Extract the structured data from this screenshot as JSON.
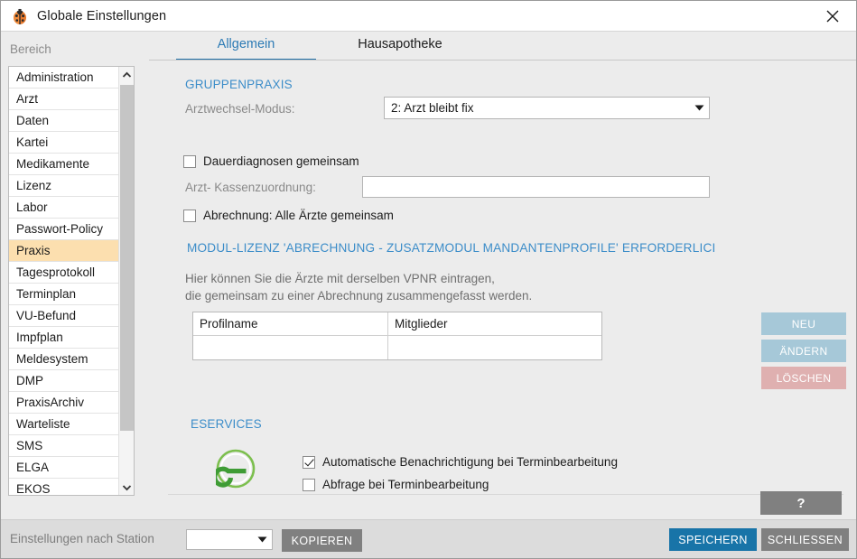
{
  "window": {
    "title": "Globale Einstellungen",
    "app_icon": "ladybug-icon",
    "close_icon": "close-icon"
  },
  "sidebar": {
    "header": "Bereich",
    "selected": "Praxis",
    "items": [
      {
        "label": "Administration"
      },
      {
        "label": "Arzt"
      },
      {
        "label": "Daten"
      },
      {
        "label": "Kartei"
      },
      {
        "label": "Medikamente"
      },
      {
        "label": "Lizenz"
      },
      {
        "label": "Labor"
      },
      {
        "label": "Passwort-Policy"
      },
      {
        "label": "Praxis"
      },
      {
        "label": "Tagesprotokoll"
      },
      {
        "label": "Terminplan"
      },
      {
        "label": "VU-Befund"
      },
      {
        "label": "Impfplan"
      },
      {
        "label": "Meldesystem"
      },
      {
        "label": "DMP"
      },
      {
        "label": "PraxisArchiv"
      },
      {
        "label": "Warteliste"
      },
      {
        "label": "SMS"
      },
      {
        "label": "ELGA"
      },
      {
        "label": "EKOS"
      }
    ],
    "scroll_up_icon": "chevron-up-icon",
    "scroll_down_icon": "chevron-down-icon"
  },
  "tabs": [
    {
      "label": "Allgemein",
      "active": true
    },
    {
      "label": "Hausapotheke",
      "active": false
    }
  ],
  "gruppenpraxis": {
    "heading": "GRUPPENPRAXIS",
    "arztwechsel_label": "Arztwechsel-Modus:",
    "arztwechsel_value": "2: Arzt bleibt fix",
    "dauerdiagnosen_label": "Dauerdiagnosen gemeinsam",
    "dauerdiagnosen_checked": false,
    "kassenzuordnung_label": "Arzt- Kassenzuordnung:",
    "kassenzuordnung_value": "",
    "kassenzuordnung_placeholder": "",
    "abrechnung_label": "Abrechnung: Alle Ärzte gemeinsam",
    "abrechnung_checked": false
  },
  "lizenz_notice": {
    "heading": "MODUL-LIZENZ 'ABRECHNUNG - ZUSATZMODUL MANDANTENPROFILE' ERFORDERLICI",
    "line1": "Hier können Sie die Ärzte mit derselben VPNR eintragen,",
    "line2": "die gemeinsam zu einer Abrechnung zusammengefasst werden."
  },
  "profile_table": {
    "columns": [
      "Profilname",
      "Mitglieder"
    ],
    "rows": [
      [
        "",
        ""
      ]
    ],
    "buttons": {
      "new": "NEU",
      "edit": "ÄNDERN",
      "delete": "LÖSCHEN"
    }
  },
  "eservices": {
    "heading": "ESERVICES",
    "logo_icon": "eservices-e-logo-icon",
    "logo_color": "#3f9c35",
    "checkbox1_label": "Automatische Benachrichtigung bei Terminbearbeitung",
    "checkbox1_checked": true,
    "checkbox2_label": "Abfrage bei Terminbearbeitung",
    "checkbox2_checked": false
  },
  "help_button": {
    "label": "?"
  },
  "footer": {
    "station_label": "Einstellungen nach Station",
    "station_value": "",
    "copy_button": "KOPIEREN",
    "save_button": "SPEICHERN",
    "close_button": "SCHLIESSEN"
  },
  "colors": {
    "accent_blue": "#1874a8",
    "tab_active": "#2d7bb5",
    "section_heading": "#3c8dc9",
    "selection_highlight": "#fcdfaf",
    "button_blue": "#a6c8d8",
    "button_red": "#dfb0b0",
    "eservices_green": "#3f9c35"
  }
}
